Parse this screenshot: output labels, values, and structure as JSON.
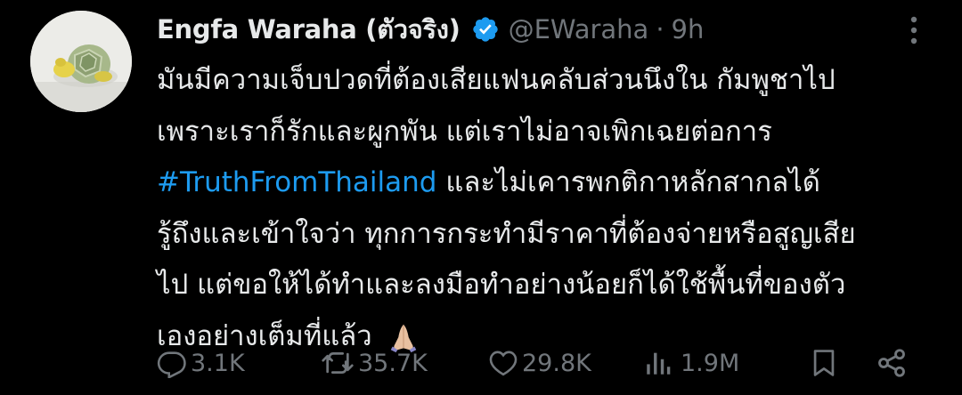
{
  "tweet": {
    "display_name": "Engfa Waraha (ตัวจริง)",
    "handle": "@EWaraha",
    "separator": "·",
    "time": "9h",
    "lines": [
      {
        "text": "มันมีความเจ็บปวดที่ต้องเสียแฟนคลับส่วนนึงใน กัมพูชาไป"
      },
      {
        "text": "เพราะเราก็รักและผูกพัน แต่เราไม่อาจเพิกเฉยต่อการ"
      },
      {
        "hashtag": "#TruthFromThailand",
        "text": " และไม่เคารพกติกาหลักสากลได้"
      },
      {
        "text": "รู้ถึงและเข้าใจว่า ทุกการกระทำมีราคาที่ต้องจ่ายหรือสูญเสีย"
      },
      {
        "text": "ไป  แต่ขอให้ได้ทำและลงมือทำอย่างน้อยก็ได้ใช้พื้นที่ของตัว"
      },
      {
        "text": "เองอย่างเต็มที่แล้ว "
      }
    ],
    "hashtag_color": "#1d9bf0",
    "emoji": "folded-hands"
  },
  "actions": {
    "replies": "3.1K",
    "reposts": "35.7K",
    "likes": "29.8K",
    "views": "1.9M"
  },
  "colors": {
    "background": "#000000",
    "text": "#e7e9ea",
    "muted": "#71767b",
    "verified": "#1d9bf0"
  }
}
